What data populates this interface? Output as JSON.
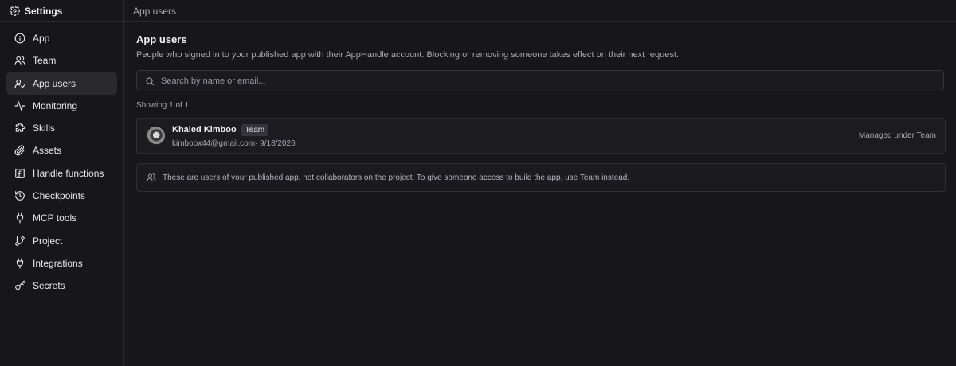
{
  "sidebar": {
    "title": "Settings",
    "items": [
      {
        "label": "App",
        "icon": "info-icon"
      },
      {
        "label": "Team",
        "icon": "users-icon"
      },
      {
        "label": "App users",
        "icon": "user-check-icon",
        "active": true
      },
      {
        "label": "Monitoring",
        "icon": "activity-icon"
      },
      {
        "label": "Skills",
        "icon": "puzzle-icon"
      },
      {
        "label": "Assets",
        "icon": "paperclip-icon"
      },
      {
        "label": "Handle functions",
        "icon": "function-icon"
      },
      {
        "label": "Checkpoints",
        "icon": "history-icon"
      },
      {
        "label": "MCP tools",
        "icon": "plug-icon"
      },
      {
        "label": "Project",
        "icon": "git-branch-icon"
      },
      {
        "label": "Integrations",
        "icon": "plug-icon"
      },
      {
        "label": "Secrets",
        "icon": "key-icon"
      }
    ]
  },
  "topbar": {
    "breadcrumb": "App users"
  },
  "main": {
    "title": "App users",
    "description": "People who signed in to your published app with their AppHandle account. Blocking or removing someone takes effect on their next request.",
    "search": {
      "placeholder": "Search by name or email...",
      "value": ""
    },
    "showing": "Showing 1 of 1",
    "users": [
      {
        "name": "Khaled Kimboo",
        "badge": "Team",
        "meta": "kimboox44@gmail.com· 9/18/2026",
        "status": "Managed under Team"
      }
    ],
    "note": "These are users of your published app, not collaborators on the project. To give someone access to build the app, use Team instead."
  }
}
